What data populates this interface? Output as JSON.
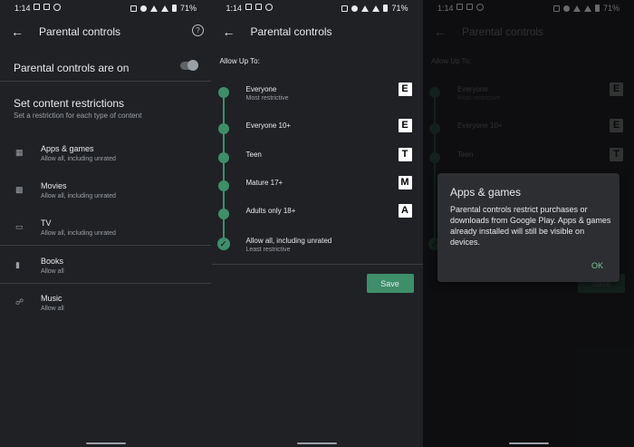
{
  "status": {
    "time": "1:14",
    "battery": "71%"
  },
  "screen1": {
    "title": "Parental controls",
    "pc_on_label": "Parental controls are on",
    "section_title": "Set content restrictions",
    "section_sub": "Set a restriction for each type of content",
    "categories": [
      {
        "name": "Apps & games",
        "sub": "Allow all, including unrated",
        "icon": "android-icon"
      },
      {
        "name": "Movies",
        "sub": "Allow all, including unrated",
        "icon": "film-icon"
      },
      {
        "name": "TV",
        "sub": "Allow all, including unrated",
        "icon": "tv-icon"
      },
      {
        "name": "Books",
        "sub": "Allow all",
        "icon": "book-icon"
      },
      {
        "name": "Music",
        "sub": "Allow all",
        "icon": "headphones-icon"
      }
    ]
  },
  "screen2": {
    "title": "Parental controls",
    "allow_label": "Allow Up To:",
    "ratings": [
      {
        "name": "Everyone",
        "sub": "Most restrictive",
        "badge": "E"
      },
      {
        "name": "Everyone 10+",
        "sub": "",
        "badge": "E"
      },
      {
        "name": "Teen",
        "sub": "",
        "badge": "T"
      },
      {
        "name": "Mature 17+",
        "sub": "",
        "badge": "M"
      },
      {
        "name": "Adults only 18+",
        "sub": "",
        "badge": "A"
      },
      {
        "name": "Allow all, including unrated",
        "sub": "Least restrictive",
        "badge": ""
      }
    ],
    "save_label": "Save"
  },
  "screen3": {
    "dialog_title": "Apps & games",
    "dialog_body": "Parental controls restrict purchases or downloads from Google Play. Apps & games already installed will still be visible on devices.",
    "ok_label": "OK"
  },
  "colors": {
    "accent": "#3e8e6a",
    "background": "#202124"
  }
}
